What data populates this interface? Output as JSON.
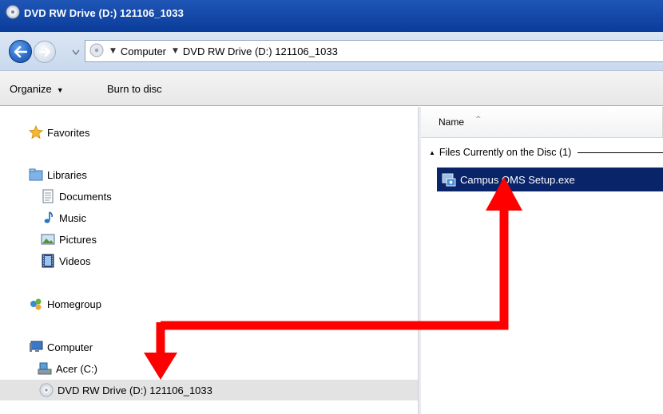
{
  "window": {
    "title": "DVD RW Drive (D:) 121106_1033",
    "icon": "dvd-drive-icon"
  },
  "address_bar": {
    "breadcrumbs": [
      "Computer",
      "DVD RW Drive (D:) 121106_1033"
    ]
  },
  "toolbar": {
    "organize_label": "Organize",
    "burn_label": "Burn to disc"
  },
  "nav_pane": {
    "favorites": "Favorites",
    "libraries": "Libraries",
    "library_items": [
      "Documents",
      "Music",
      "Pictures",
      "Videos"
    ],
    "homegroup": "Homegroup",
    "computer": "Computer",
    "drives": [
      "Acer (C:)",
      "DVD RW Drive (D:) 121106_1033"
    ],
    "selected_item": "DVD RW Drive (D:) 121106_1033"
  },
  "content": {
    "column_header": "Name",
    "group_label": "Files Currently on the Disc (1)",
    "files": [
      {
        "name": "Campus QMS Setup.exe",
        "icon": "setup-installer-icon",
        "selected": true
      }
    ]
  },
  "colors": {
    "titlebar": "#0a3c9a",
    "selection": "#0a246a",
    "annotation_arrow": "#ff0000"
  }
}
